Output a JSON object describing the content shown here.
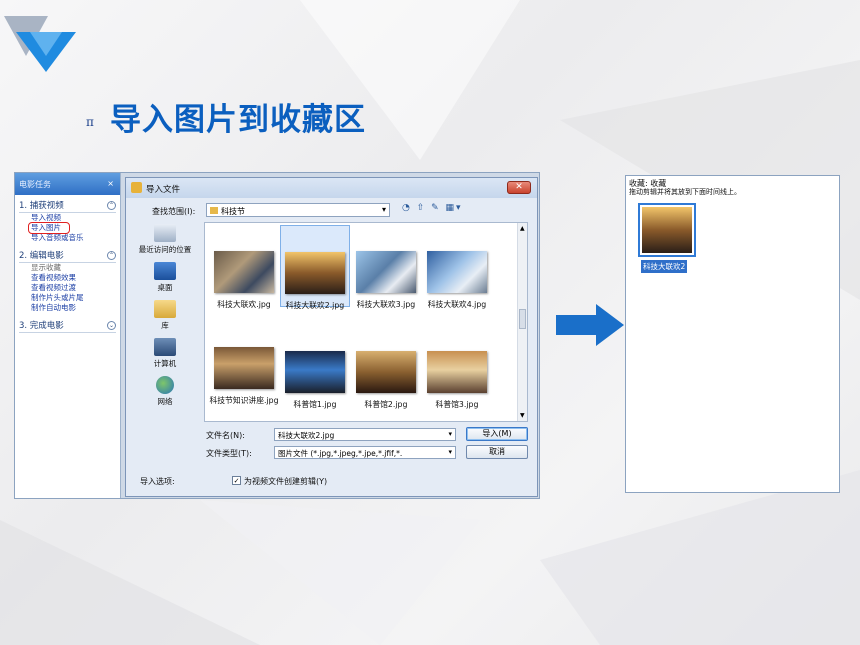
{
  "slide": {
    "title": "导入图片到收藏区",
    "bullet_glyph": "π"
  },
  "task_pane": {
    "header": "电影任务",
    "close": "×",
    "sections": [
      {
        "title": "1. 捕获视频",
        "toggle": "⌃",
        "links": [
          "导入视频",
          "导入图片",
          "导入音频或音乐"
        ]
      },
      {
        "title": "2. 编辑电影",
        "toggle": "⌃",
        "muted": "显示收藏",
        "links": [
          "查看视频效果",
          "查看视频过渡",
          "制作片头或片尾",
          "制作自动电影"
        ]
      },
      {
        "title": "3. 完成电影",
        "toggle": "⌄",
        "links": []
      }
    ]
  },
  "dialog": {
    "title": "导入文件",
    "close": "✕",
    "lookin_label": "查找范围(I):",
    "lookin_value": "科技节",
    "nav_icons": "◔ ⇧ ✎ ▦▾",
    "places": [
      "最近访问的位置",
      "桌面",
      "库",
      "计算机",
      "网络"
    ],
    "files": [
      "科技大联欢.jpg",
      "科技大联欢2.jpg",
      "科技大联欢3.jpg",
      "科技大联欢4.jpg",
      "科技节知识讲座.jpg",
      "科普馆1.jpg",
      "科普馆2.jpg",
      "科普馆3.jpg"
    ],
    "filename_label": "文件名(N):",
    "filename_value": "科技大联欢2.jpg",
    "filetype_label": "文件类型(T):",
    "filetype_value": "图片文件 (*.jpg,*.jpeg,*.jpe,*.jfif,*.",
    "import_button": "导入(M)",
    "cancel_button": "取消",
    "import_options_label": "导入选项:",
    "checkbox_checked": "✓",
    "checkbox_label": "为视频文件创建剪辑(Y)"
  },
  "collection": {
    "header": "收藏: 收藏",
    "subheader": "拖动剪辑并将其放到下面时间线上。",
    "item_label": "科技大联欢2"
  },
  "colors": {
    "title_blue": "#0b5fbf",
    "arrow_blue": "#1a6fc9",
    "selection_blue": "#2f6fc9",
    "highlight_red": "#e02020"
  }
}
